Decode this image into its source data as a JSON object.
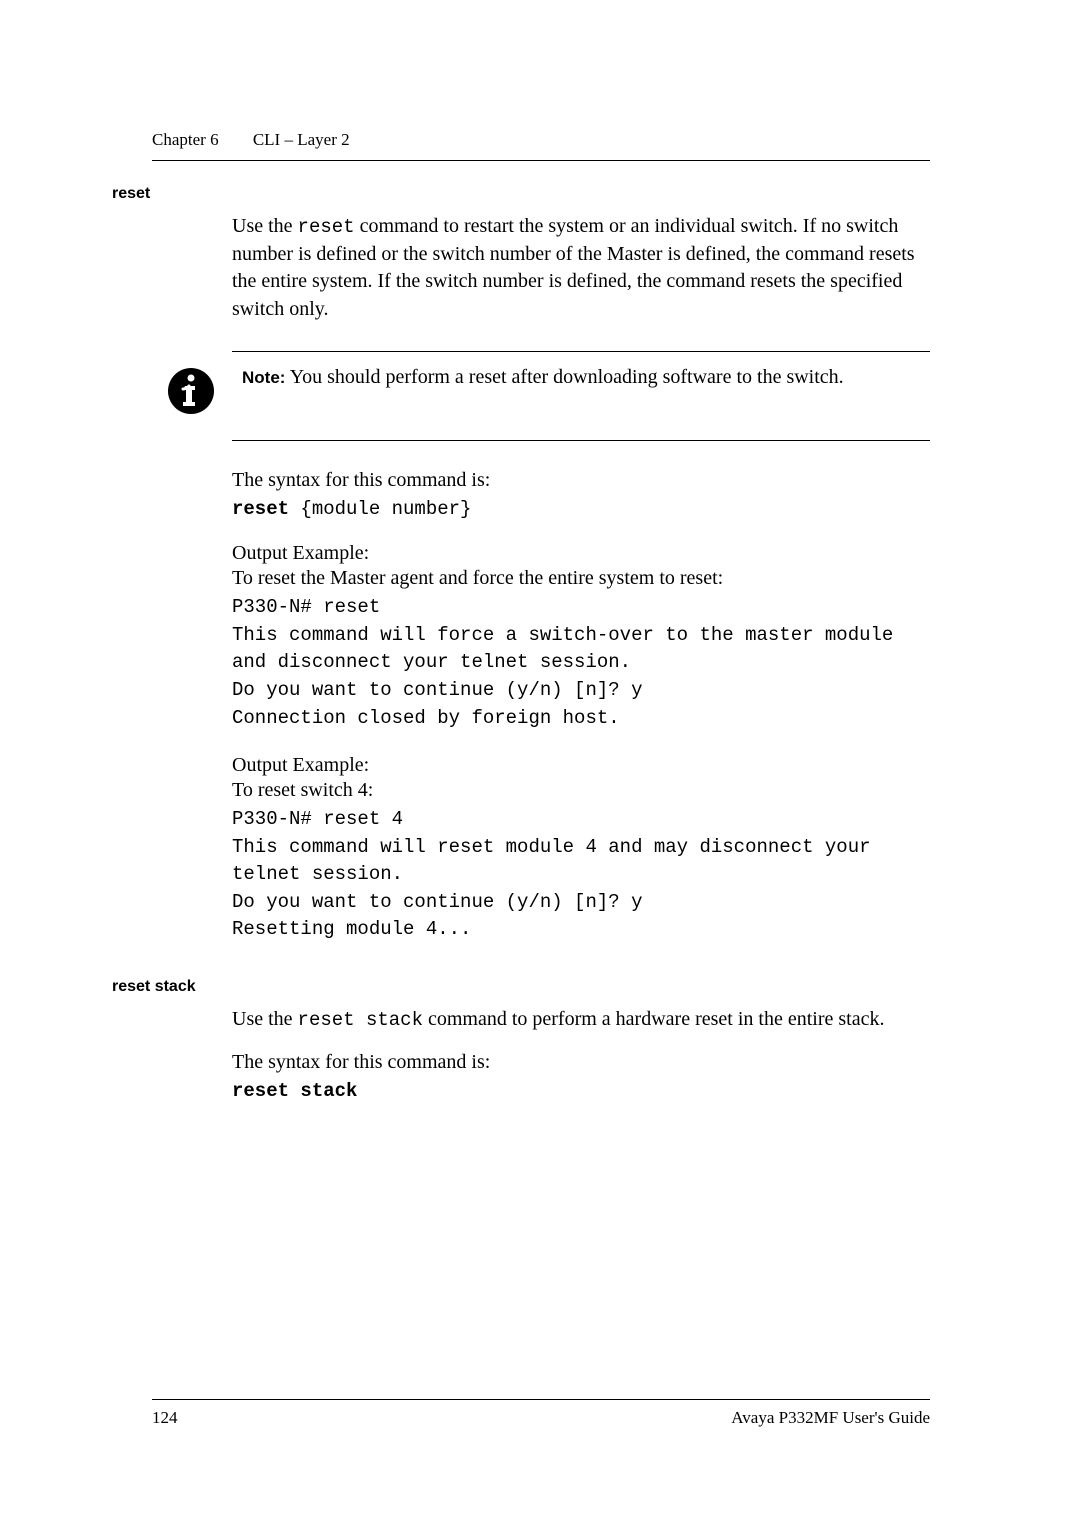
{
  "header": {
    "chapter_label": "Chapter 6",
    "chapter_title": "CLI – Layer 2"
  },
  "reset": {
    "title": "reset",
    "intro_prefix": "Use the ",
    "intro_code": "reset",
    "intro_suffix": " command to restart the system or an individual switch. If no switch number is defined or the switch number of the Master is defined, the command resets the entire system. If the switch number is defined, the command resets the specified switch only.",
    "note_label": "Note:",
    "note_text": " You should perform a reset after downloading software to the switch.",
    "syntax_intro": "The syntax for this command is:",
    "syntax_kw": "reset",
    "syntax_rest": " {module number}",
    "ex1": {
      "head": "Output Example:",
      "sub": "To reset the Master agent and force the entire system to reset:",
      "l1": "P330-N# reset",
      "l2": "This command will force a switch-over to the master module and disconnect your telnet session.",
      "l3": "Do you want to continue (y/n) [n]? y",
      "l4": "Connection closed by foreign host."
    },
    "ex2": {
      "head": "Output Example:",
      "sub": "To reset switch 4:",
      "l1": "P330-N# reset 4",
      "l2": "This command will reset module 4 and may disconnect your telnet session.",
      "l3": "Do you want to continue (y/n) [n]? y",
      "l4": "Resetting module 4..."
    }
  },
  "reset_stack": {
    "title": "reset stack",
    "intro_prefix": "Use the ",
    "intro_code": "reset stack",
    "intro_suffix": " command to perform a hardware reset in the entire stack.",
    "syntax_intro": "The syntax for this command is:",
    "syntax_kw": "reset stack"
  },
  "footer": {
    "page": "124",
    "book": "Avaya P332MF User's Guide"
  }
}
